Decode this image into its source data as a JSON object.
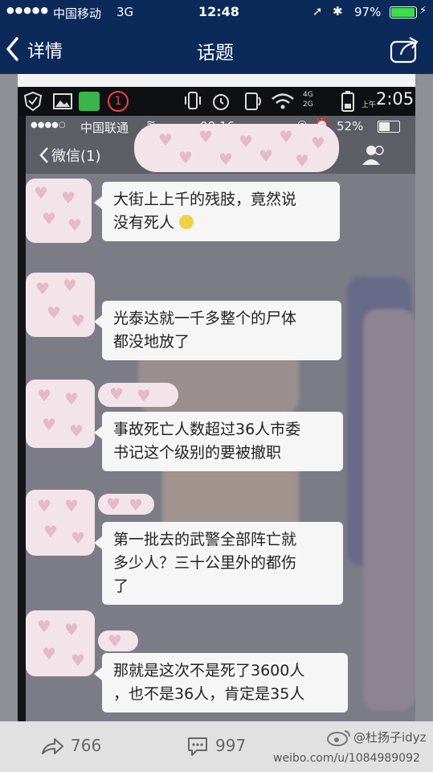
{
  "outer_status": {
    "carrier": "中国移动",
    "network": "3G",
    "time": "12:48",
    "battery": "97%"
  },
  "nav": {
    "back_label": "详情",
    "title": "话题"
  },
  "inner_android": {
    "time": "2:05",
    "network_4g": "4G",
    "network_2g": "2G",
    "am_pm": "上午"
  },
  "wechat": {
    "status_carrier": "中国联通",
    "status_time": "08:16",
    "status_battery": "52%",
    "back_label": "微信(1)"
  },
  "messages": [
    {
      "text_line1": "大街上上千的残肢，竟然说",
      "text_line2": "没有死人"
    },
    {
      "text_line1": "光泰达就一千多整个的尸体",
      "text_line2": "都没地放了"
    },
    {
      "text_line1": "事故死亡人数超过36人市委",
      "text_line2": "书记这个级别的要被撤职"
    },
    {
      "text_line1": "第一批去的武警全部阵亡就",
      "text_line2": "多少人？三十公里外的都伤",
      "text_line3": "了"
    },
    {
      "text_line1": "那就是这次不是死了3600人",
      "text_line2": "，也不是36人，肯定是35人"
    }
  ],
  "bottom": {
    "share_count": "766",
    "comment_count": "997",
    "watermark_user": "@杜扬子idyz",
    "watermark_url": "weibo.com/u/1084989092"
  },
  "colors": {
    "nav_bg": "#0b2a5a",
    "bubble_bg": "#f6f6f6",
    "battery_green": "#3ddc4a"
  }
}
